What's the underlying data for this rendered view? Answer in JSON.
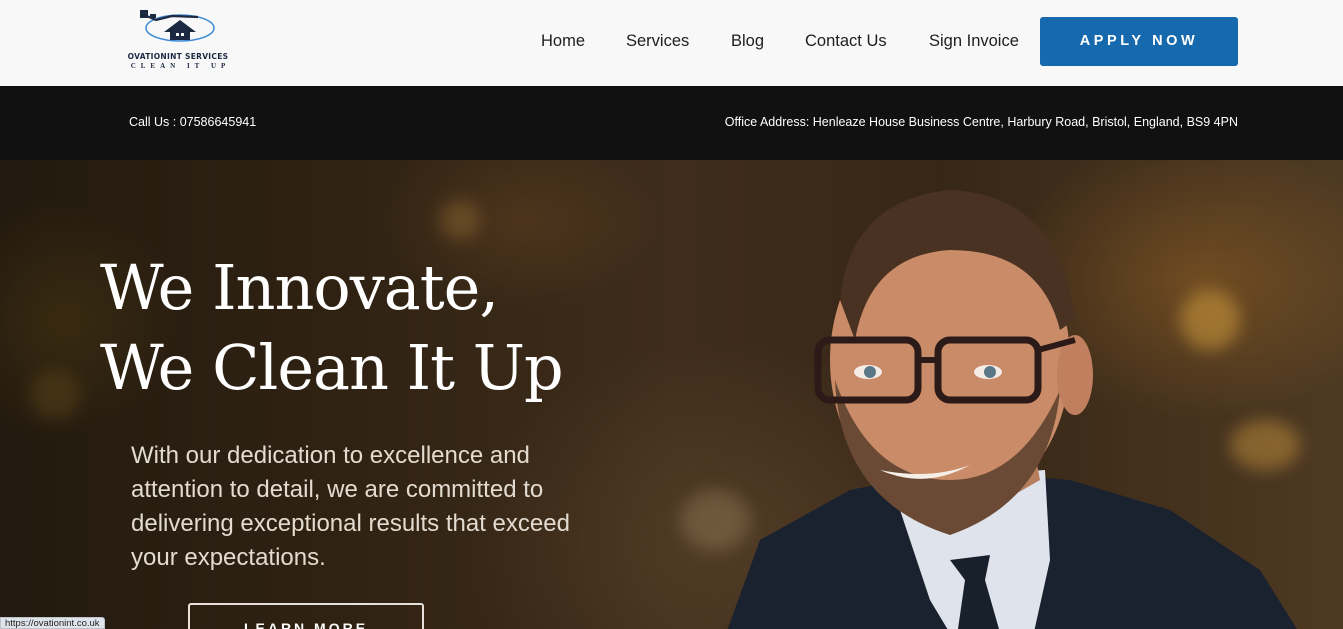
{
  "header": {
    "logo": {
      "name": "OVATIONINT SERVICES",
      "tagline": "CLEAN IT UP",
      "icon": "pressure-washer-house-icon"
    },
    "nav": [
      {
        "label": "Home"
      },
      {
        "label": "Services"
      },
      {
        "label": "Blog"
      },
      {
        "label": "Contact Us"
      },
      {
        "label": "Sign Invoice"
      }
    ],
    "apply_label": "APPLY NOW"
  },
  "infobar": {
    "call": "Call Us : 07586645941",
    "address": "Office Address: Henleaze House Business Centre, Harbury Road, Bristol, England, BS9 4PN"
  },
  "hero": {
    "headline_line1": "We Innovate,",
    "headline_line2": "We Clean It Up",
    "subtext": "With our dedication to excellence and attention to detail, we are committed to delivering exceptional results that exceed your expectations.",
    "button_label": "LEARN MORE"
  },
  "status_bar": {
    "url": "https://ovationint.co.uk"
  },
  "colors": {
    "accent": "#1669ad",
    "infobar_bg": "#111111",
    "header_bg": "#f8f8f8"
  }
}
